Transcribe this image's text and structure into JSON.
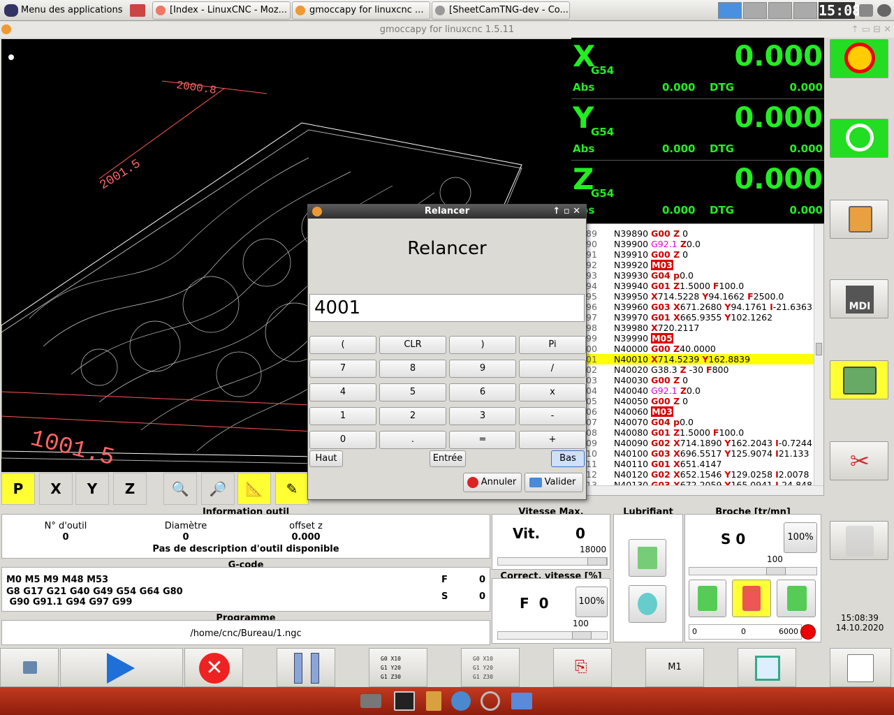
{
  "topbar": {
    "app_menu": "Menu des applications",
    "tasks": [
      "[Index - LinuxCNC - Moz...",
      "gmoccapy for linuxcnc  ...",
      "[SheetCamTNG-dev - Co..."
    ],
    "clock": "15:08"
  },
  "window": {
    "title": "gmoccapy for linuxcnc  1.5.11"
  },
  "view3d": {
    "dim_top": "2000.8",
    "dim_left": "2001.5",
    "dim_bottom": "1001.5"
  },
  "view_toolbar": {
    "p": "P",
    "x": "X",
    "y": "Y",
    "z": "Z"
  },
  "dro": {
    "axes": [
      {
        "axis": "X",
        "wcs": "G54",
        "value": "0.000",
        "abs_label": "Abs",
        "abs": "0.000",
        "dtg_label": "DTG",
        "dtg": "0.000"
      },
      {
        "axis": "Y",
        "wcs": "G54",
        "value": "0.000",
        "abs_label": "Abs",
        "abs": "0.000",
        "dtg_label": "DTG",
        "dtg": "0.000"
      },
      {
        "axis": "Z",
        "wcs": "G54",
        "value": "0.000",
        "abs_label": "Abs",
        "abs": "0.000",
        "dtg_label": "DTG",
        "dtg": "0.000"
      }
    ]
  },
  "gcode_lines": [
    {
      "n": "89",
      "code": [
        [
          "",
          "N39890 "
        ],
        [
          "kw",
          "G00"
        ],
        [
          "kw",
          " Z"
        ],
        [
          "",
          " 0"
        ]
      ]
    },
    {
      "n": "90",
      "code": [
        [
          "",
          "N39900 "
        ],
        [
          "kwm",
          "G92.1"
        ],
        [
          "kw",
          " Z"
        ],
        [
          "",
          "0.0"
        ]
      ]
    },
    {
      "n": "91",
      "code": [
        [
          "",
          "N39910 "
        ],
        [
          "kw",
          "G00"
        ],
        [
          "kw",
          " Z"
        ],
        [
          "",
          " 0"
        ]
      ]
    },
    {
      "n": "92",
      "code": [
        [
          "",
          "N39920 "
        ],
        [
          "kwb",
          "M03"
        ]
      ]
    },
    {
      "n": "93",
      "code": [
        [
          "",
          "N39930 "
        ],
        [
          "kw",
          "G04"
        ],
        [
          "kw",
          " p"
        ],
        [
          "",
          "0.0"
        ]
      ]
    },
    {
      "n": "94",
      "code": [
        [
          "",
          "N39940 "
        ],
        [
          "kw",
          "G01"
        ],
        [
          "kw",
          " Z"
        ],
        [
          "",
          "1.5000 "
        ],
        [
          "kw",
          "F"
        ],
        [
          "",
          "100.0"
        ]
      ]
    },
    {
      "n": "95",
      "code": [
        [
          "",
          "N39950 "
        ],
        [
          "kw",
          "X"
        ],
        [
          "",
          "714.5228 "
        ],
        [
          "kw",
          "Y"
        ],
        [
          "",
          "94.1662 "
        ],
        [
          "kw",
          "F"
        ],
        [
          "",
          "2500.0"
        ]
      ]
    },
    {
      "n": "96",
      "code": [
        [
          "",
          "N39960 "
        ],
        [
          "kw",
          "G03"
        ],
        [
          "kw",
          " X"
        ],
        [
          "",
          "671.2680 "
        ],
        [
          "kw",
          "Y"
        ],
        [
          "",
          "94.1761 "
        ],
        [
          "kw",
          "I"
        ],
        [
          "",
          "-21.6363"
        ]
      ]
    },
    {
      "n": "97",
      "code": [
        [
          "",
          "N39970 "
        ],
        [
          "kw",
          "G01"
        ],
        [
          "kw",
          " X"
        ],
        [
          "",
          "665.9355 "
        ],
        [
          "kw",
          "Y"
        ],
        [
          "",
          "102.1262"
        ]
      ]
    },
    {
      "n": "98",
      "code": [
        [
          "",
          "N39980 "
        ],
        [
          "kw",
          "X"
        ],
        [
          "",
          "720.2117"
        ]
      ]
    },
    {
      "n": "99",
      "code": [
        [
          "",
          "N39990 "
        ],
        [
          "kwb",
          "M05"
        ]
      ]
    },
    {
      "n": "00",
      "code": [
        [
          "",
          "N40000 "
        ],
        [
          "kw",
          "G00"
        ],
        [
          "kw",
          " Z"
        ],
        [
          "",
          "40.0000"
        ]
      ]
    },
    {
      "n": "01",
      "hl": true,
      "code": [
        [
          "",
          "N40010 "
        ],
        [
          "kw",
          "X"
        ],
        [
          "",
          "714.5239 "
        ],
        [
          "kw",
          "Y"
        ],
        [
          "",
          "162.8839"
        ]
      ]
    },
    {
      "n": "02",
      "code": [
        [
          "",
          "N40020 G38.3 "
        ],
        [
          "kw",
          "Z"
        ],
        [
          "",
          " -30 "
        ],
        [
          "kw",
          "F"
        ],
        [
          "",
          "800"
        ]
      ]
    },
    {
      "n": "03",
      "code": [
        [
          "",
          "N40030 "
        ],
        [
          "kw",
          "G00"
        ],
        [
          "kw",
          " Z"
        ],
        [
          "",
          " 0"
        ]
      ]
    },
    {
      "n": "04",
      "code": [
        [
          "",
          "N40040 "
        ],
        [
          "kwm",
          "G92.1"
        ],
        [
          "kw",
          " Z"
        ],
        [
          "",
          "0.0"
        ]
      ]
    },
    {
      "n": "05",
      "code": [
        [
          "",
          "N40050 "
        ],
        [
          "kw",
          "G00"
        ],
        [
          "kw",
          " Z"
        ],
        [
          "",
          " 0"
        ]
      ]
    },
    {
      "n": "06",
      "code": [
        [
          "",
          "N40060 "
        ],
        [
          "kwb",
          "M03"
        ]
      ]
    },
    {
      "n": "07",
      "code": [
        [
          "",
          "N40070 "
        ],
        [
          "kw",
          "G04"
        ],
        [
          "kw",
          " p"
        ],
        [
          "",
          "0.0"
        ]
      ]
    },
    {
      "n": "08",
      "code": [
        [
          "",
          "N40080 "
        ],
        [
          "kw",
          "G01"
        ],
        [
          "kw",
          " Z"
        ],
        [
          "",
          "1.5000 "
        ],
        [
          "kw",
          "F"
        ],
        [
          "",
          "100.0"
        ]
      ]
    },
    {
      "n": "09",
      "code": [
        [
          "",
          "N40090 "
        ],
        [
          "kw",
          "G02"
        ],
        [
          "kw",
          " X"
        ],
        [
          "",
          "714.1890 "
        ],
        [
          "kw",
          "Y"
        ],
        [
          "",
          "162.2043 "
        ],
        [
          "kw",
          "I"
        ],
        [
          "",
          "-0.7244"
        ]
      ]
    },
    {
      "n": "10",
      "code": [
        [
          "",
          "N40100 "
        ],
        [
          "kw",
          "G03"
        ],
        [
          "kw",
          " X"
        ],
        [
          "",
          "696.5517 "
        ],
        [
          "kw",
          "Y"
        ],
        [
          "",
          "125.9074 "
        ],
        [
          "kw",
          "I"
        ],
        [
          "",
          "21.133"
        ]
      ]
    },
    {
      "n": "11",
      "code": [
        [
          "",
          "N40110 "
        ],
        [
          "kw",
          "G01"
        ],
        [
          "kw",
          " X"
        ],
        [
          "",
          "651.4147"
        ]
      ]
    },
    {
      "n": "12",
      "code": [
        [
          "",
          "N40120 "
        ],
        [
          "kw",
          "G02"
        ],
        [
          "kw",
          " X"
        ],
        [
          "",
          "652.1546 "
        ],
        [
          "kw",
          "Y"
        ],
        [
          "",
          "129.0258 "
        ],
        [
          "kw",
          "I"
        ],
        [
          "",
          "2.0078"
        ]
      ]
    },
    {
      "n": "13",
      "code": [
        [
          "",
          "N40130 "
        ],
        [
          "kw",
          "G03"
        ],
        [
          "kw",
          " X"
        ],
        [
          "",
          "672.2059 "
        ],
        [
          "kw",
          "Y"
        ],
        [
          "",
          "165.0941 "
        ],
        [
          "kw",
          "I"
        ],
        [
          "",
          "-24.848"
        ]
      ]
    }
  ],
  "dialog": {
    "title": "Relancer",
    "heading": "Relancer",
    "entry": "4001",
    "keys": [
      "(",
      "CLR",
      ")",
      "Pi",
      "7",
      "8",
      "9",
      "/",
      "4",
      "5",
      "6",
      "x",
      "1",
      "2",
      "3",
      "-",
      "0",
      ".",
      "=",
      "+"
    ],
    "haut": "Haut",
    "entree": "Entrée",
    "bas": "Bas",
    "cancel": "Annuler",
    "ok": "Valider"
  },
  "tool_info": {
    "title": "Information outil",
    "col1_label": "N° d'outil",
    "col1_value": "0",
    "col2_label": "Diamètre",
    "col2_value": "0",
    "col3_label": "offset z",
    "col3_value": "0.000",
    "description": "Pas de description d'outil disponible"
  },
  "gcode_info": {
    "title": "G-code",
    "line1": "M0 M5 M9 M48 M53",
    "line2": "G8 G17 G21 G40 G49 G54 G64 G80",
    "line3": " G90 G91.1 G94 G97 G99",
    "f_label": "F",
    "f_value": "0",
    "s_label": "S",
    "s_value": "0"
  },
  "program": {
    "title": "Programme",
    "path": "/home/cnc/Bureau/1.ngc"
  },
  "max_speed": {
    "title": "Vitesse Max.",
    "label": "Vit.",
    "value": "0",
    "scale": "18000"
  },
  "feed_override": {
    "title": "Correct. vitesse [%]",
    "label": "F  0",
    "pct": "100%",
    "scale": "100"
  },
  "coolant": {
    "title": "Lubrifiant"
  },
  "spindle": {
    "title": "Broche [tr/mn]",
    "value": "S 0",
    "pct": "100%",
    "scale": "100",
    "bar_min": "0",
    "bar_val": "0",
    "bar_max": "6000"
  },
  "datetime": {
    "time": "15:08:39",
    "date": "14.10.2020"
  },
  "bottom": {
    "m1": "M1"
  },
  "colors": {
    "dro_green": "#22ee22",
    "highlight": "#ffff00",
    "keyword": "#cc0000"
  }
}
